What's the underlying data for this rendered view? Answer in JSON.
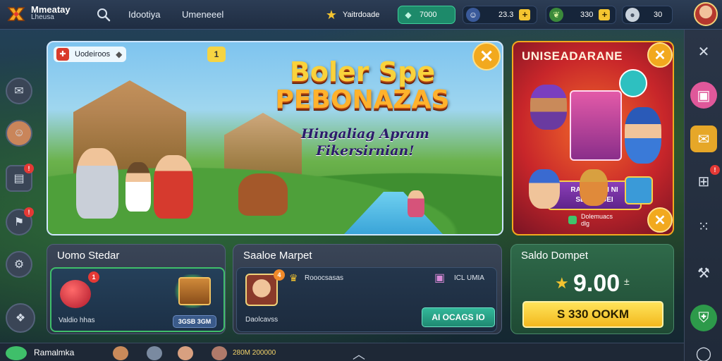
{
  "app": {
    "brand_line1": "Mmeatay",
    "brand_line2": "Lheusa",
    "nav": [
      "Idootiya",
      "Umeneeel"
    ]
  },
  "currencies": [
    {
      "icon": "star-icon",
      "label": "Yaitrdoade",
      "value": ""
    },
    {
      "icon": "gem-icon",
      "label": "",
      "value": "7000"
    },
    {
      "icon": "hero-icon",
      "label": "",
      "value": "23.3"
    },
    {
      "icon": "leaf-icon",
      "label": "",
      "value": "330"
    },
    {
      "icon": "coin-icon",
      "label": "",
      "value": "30"
    }
  ],
  "hero": {
    "top_label": "Uodeiroos",
    "yellow_badge": "1",
    "title_line1": "Boler Spe",
    "title_line2": "PEBONAZAS",
    "subtitle_line1": "Hingaliag Apram",
    "subtitle_line2": "Fikersirnian!"
  },
  "promo": {
    "title": "UNISEADARANE",
    "ribbon_line1": "RAIMCNKN NI",
    "ribbon_line2": "SBGONUEI",
    "foot_line1": "Dolemuacs",
    "foot_line2": "dlg"
  },
  "panels": {
    "left": {
      "title": "Uomo Stedar",
      "badge": "1",
      "caption": "Valdio hhas",
      "button": "3GSB 3GM"
    },
    "middle": {
      "title": "Saaloe Marpet",
      "badge": "4",
      "item1": "Rooocsasas",
      "item2": "ICL UMIA",
      "caption": "Daolcavss",
      "button": "AI OCAGS IO"
    },
    "right": {
      "title": "Saldo Dompet",
      "amount": "9.00",
      "suffix": "±",
      "button": "S 330 OOKM"
    }
  },
  "bottombar": {
    "name": "Ramalmka",
    "value": "280M 200000"
  },
  "colors": {
    "topbar": "#2c3d55",
    "accent_green": "#3fbf6a",
    "accent_gold": "#f4c430",
    "alert_red": "#e53935"
  }
}
